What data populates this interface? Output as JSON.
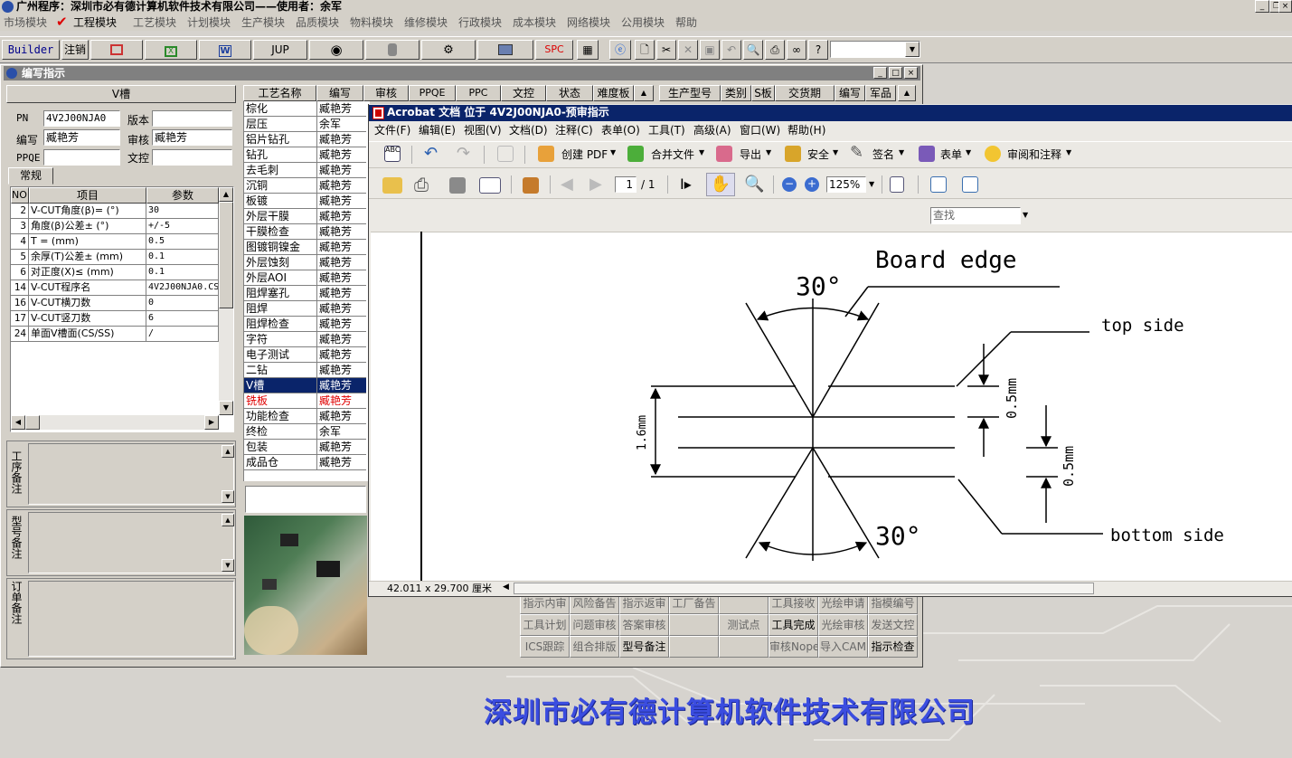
{
  "app": {
    "title": "广州程序：深圳市必有德计算机软件技术有限公司——使用者：余军",
    "company_banner": "深圳市必有德计算机软件技术有限公司"
  },
  "menubar": [
    "市场模块",
    "工程模块",
    "工艺模块",
    "计划模块",
    "生产模块",
    "品质模块",
    "物料模块",
    "维修模块",
    "行政模块",
    "成本模块",
    "网络模块",
    "公用模块",
    "帮助"
  ],
  "toolbar": [
    "Builder",
    "注销",
    "JUP",
    "SPC"
  ],
  "child_window": {
    "title": "编写指示"
  },
  "info_panel": {
    "title": "V槽",
    "pn_label": "PN",
    "pn_value": "4V2J00NJA0",
    "version_label": "版本",
    "version_value": "",
    "writer_label": "编写",
    "writer_value": "臧艳芳",
    "review_label": "审核",
    "review_value": "臧艳芳",
    "ppqe_label": "PPQE",
    "ppqe_value": "",
    "doc_label": "文控",
    "doc_value": "",
    "tab_label": "常规"
  },
  "param_table": {
    "headers": [
      "NO",
      "项目",
      "参数"
    ],
    "rows": [
      [
        "2",
        "V-CUT角度(β)= (°)",
        "30"
      ],
      [
        "3",
        "角度(β)公差± (°)",
        "+/-5"
      ],
      [
        "4",
        "T = (mm)",
        "0.5"
      ],
      [
        "5",
        "余厚(T)公差± (mm)",
        "0.1"
      ],
      [
        "6",
        "对正度(X)≤ (mm)",
        "0.1"
      ],
      [
        "14",
        "V-CUT程序名",
        "4V2J00NJA0.CS"
      ],
      [
        "16",
        "V-CUT横刀数",
        "0"
      ],
      [
        "17",
        "V-CUT竖刀数",
        "6"
      ],
      [
        "24",
        "单面V槽面(CS/SS)",
        "/"
      ]
    ]
  },
  "notes": [
    {
      "label": "工序备注"
    },
    {
      "label": "型号备注"
    },
    {
      "label": "订单备注"
    }
  ],
  "process_table": {
    "headers": [
      "工艺名称",
      "编写",
      "审核",
      "PPQE",
      "PPC",
      "文控",
      "状态",
      "难度板"
    ],
    "rows": [
      [
        "棕化",
        "臧艳芳"
      ],
      [
        "层压",
        "余军"
      ],
      [
        "铝片钻孔",
        "臧艳芳"
      ],
      [
        "钻孔",
        "臧艳芳"
      ],
      [
        "去毛刺",
        "臧艳芳"
      ],
      [
        "沉铜",
        "臧艳芳"
      ],
      [
        "板镀",
        "臧艳芳"
      ],
      [
        "外层干膜",
        "臧艳芳"
      ],
      [
        "干膜检查",
        "臧艳芳"
      ],
      [
        "图镀铜镍金",
        "臧艳芳"
      ],
      [
        "外层蚀刻",
        "臧艳芳"
      ],
      [
        "外层AOI",
        "臧艳芳"
      ],
      [
        "阻焊塞孔",
        "臧艳芳"
      ],
      [
        "阻焊",
        "臧艳芳"
      ],
      [
        "阻焊检查",
        "臧艳芳"
      ],
      [
        "字符",
        "臧艳芳"
      ],
      [
        "电子测试",
        "臧艳芳"
      ],
      [
        "二钻",
        "臧艳芳"
      ],
      [
        "V槽",
        "臧艳芳"
      ],
      [
        "铣板",
        "臧艳芳"
      ],
      [
        "功能检查",
        "臧艳芳"
      ],
      [
        "终检",
        "余军"
      ],
      [
        "包装",
        "臧艳芳"
      ],
      [
        "成品仓",
        "臧艳芳"
      ]
    ],
    "selected": "V槽",
    "highlight": "铣板"
  },
  "right_table": {
    "headers": [
      "生产型号",
      "类别",
      "S板",
      "交货期",
      "编写",
      "军品"
    ]
  },
  "bottom_grid": {
    "row0": [
      "指示内审",
      "风险备告",
      "指示返审",
      "工厂备告",
      "",
      "工具接收",
      "光绘申请",
      "指模编号"
    ],
    "row1": [
      "工具计划",
      "问题审核",
      "答案审核",
      "",
      "测试点",
      "工具完成",
      "光绘审核",
      "发送文控"
    ],
    "row2": [
      "ICS跟踪",
      "组合排版",
      "型号备注",
      "",
      "",
      "审核Nope",
      "导入CAM",
      "指示检查"
    ]
  },
  "acrobat": {
    "title": "Acrobat 文档 位于 4V2J00NJA0-预审指示",
    "menu": [
      "文件(F)",
      "编辑(E)",
      "视图(V)",
      "文档(D)",
      "注释(C)",
      "表单(O)",
      "工具(T)",
      "高级(A)",
      "窗口(W)",
      "帮助(H)"
    ],
    "toolbar1": [
      "创建 PDF",
      "合并文件",
      "导出",
      "安全",
      "签名",
      "表单",
      "审阅和注释"
    ],
    "page_current": "1",
    "page_total": "/ 1",
    "zoom": "125%",
    "search_placeholder": "查找",
    "status_size": "42.011 x 29.700 厘米"
  },
  "drawing": {
    "board_edge": "Board edge",
    "top_side": "top side",
    "bottom_side": "bottom side",
    "angle_top": "30°",
    "angle_bottom": "30°",
    "thickness": "1.6mm",
    "depth_top": "0.5mm",
    "depth_bottom": "0.5mm"
  }
}
